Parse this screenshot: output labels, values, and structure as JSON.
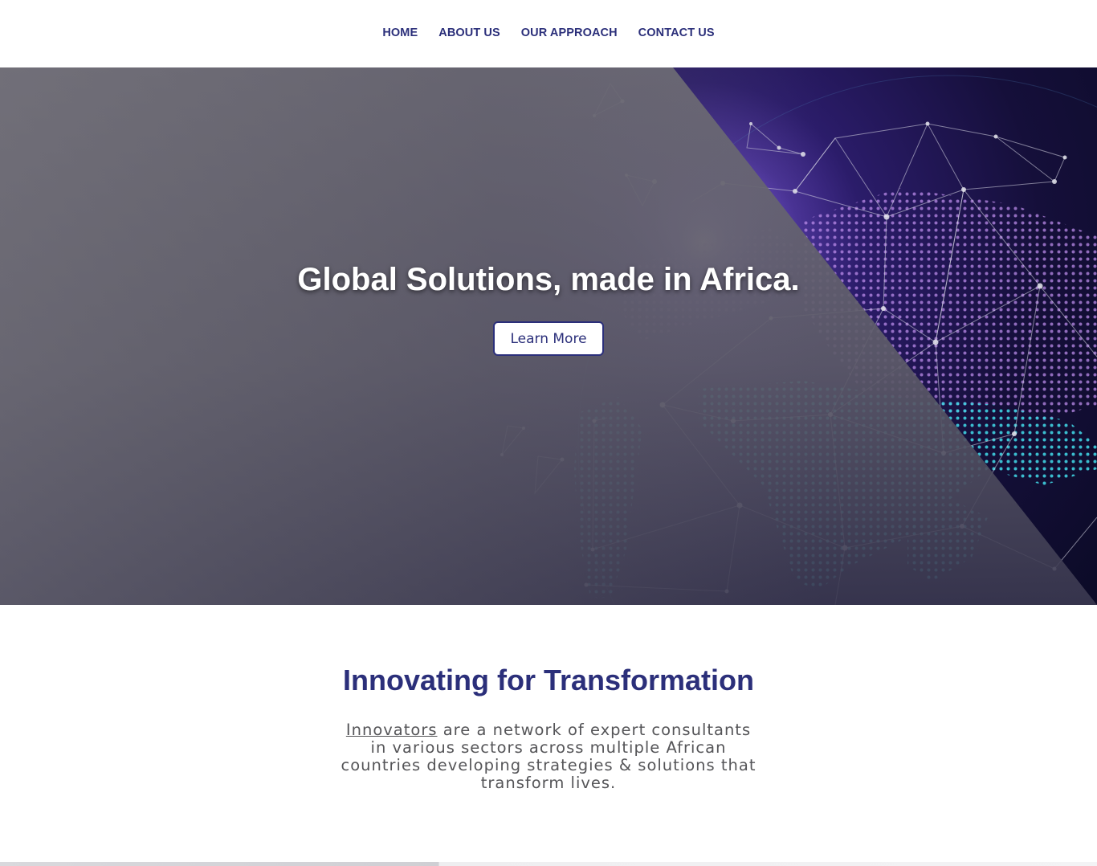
{
  "nav": {
    "items": [
      {
        "label": "HOME"
      },
      {
        "label": "ABOUT US"
      },
      {
        "label": "OUR APPROACH"
      },
      {
        "label": "CONTACT US"
      }
    ]
  },
  "hero": {
    "title": "Global Solutions, made in Africa.",
    "button_label": "Learn More",
    "background_image": "globe-network-icon"
  },
  "intro": {
    "title": "Innovating for Transformation",
    "link_text": "Innovators",
    "body": " are a network of expert consultants in various sectors across multiple African countries developing strategies & solutions that transform lives."
  },
  "colors": {
    "brand": "#2b2f7a",
    "text": "#555558",
    "hero_dots": "#3fd0e0"
  }
}
